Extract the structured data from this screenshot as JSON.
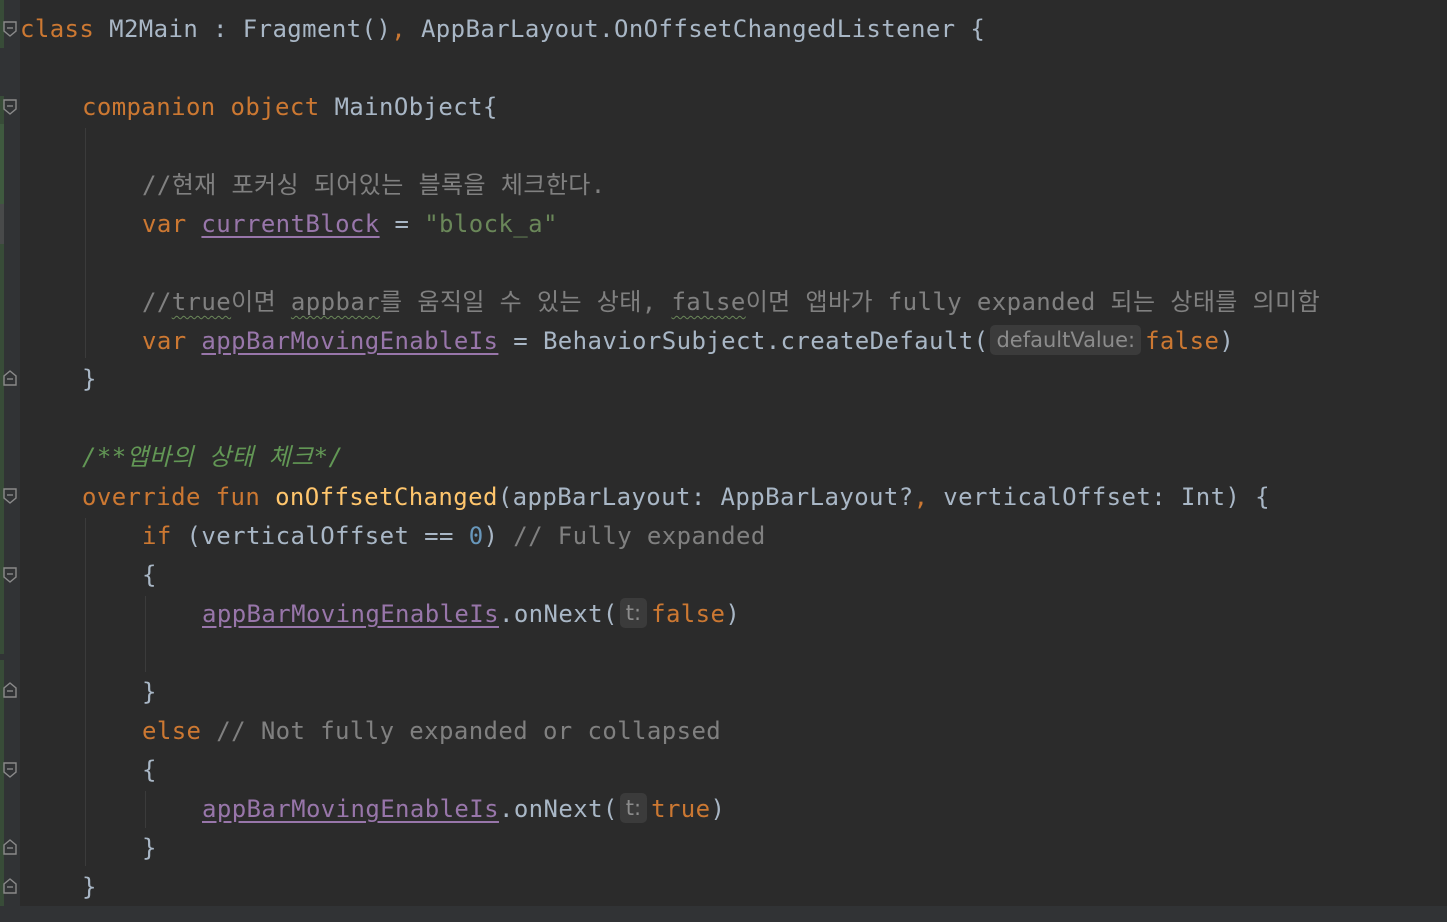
{
  "editor": {
    "lines": [
      {
        "id": "class-decl",
        "tokens": [
          {
            "t": "class",
            "c": "kw"
          },
          {
            "t": " M2Main : Fragment()",
            "c": "plain"
          },
          {
            "t": ",",
            "c": "kw"
          },
          {
            "t": " AppBarLayout.OnOffsetChangedListener {",
            "c": "plain"
          }
        ]
      },
      {
        "id": "companion-decl",
        "tokens": [
          {
            "t": "companion object",
            "c": "kw"
          },
          {
            "t": " MainObject{",
            "c": "plain"
          }
        ]
      },
      {
        "id": "comment-current-block",
        "tokens": [
          {
            "t": "//현재 포커싱 되어있는 블록을 체크한다.",
            "c": "comment"
          }
        ]
      },
      {
        "id": "var-current-block",
        "tokens": [
          {
            "t": "var",
            "c": "kw"
          },
          {
            "t": " ",
            "c": "plain"
          },
          {
            "t": "currentBlock",
            "c": "prop"
          },
          {
            "t": " = ",
            "c": "plain"
          },
          {
            "t": "\"block_a\"",
            "c": "str"
          }
        ]
      },
      {
        "id": "comment-appbar",
        "tokens": [
          {
            "t": "//",
            "c": "comment"
          },
          {
            "t": "true",
            "c": "comment typo"
          },
          {
            "t": "이면 ",
            "c": "comment"
          },
          {
            "t": "appbar",
            "c": "comment typo"
          },
          {
            "t": "를 움직일 수 있는 상태, ",
            "c": "comment"
          },
          {
            "t": "false",
            "c": "comment typo"
          },
          {
            "t": "이면 앱바가 fully expanded 되는 상태를 의미함",
            "c": "comment"
          }
        ]
      },
      {
        "id": "var-appbar-enable",
        "tokens": [
          {
            "t": "var",
            "c": "kw"
          },
          {
            "t": " ",
            "c": "plain"
          },
          {
            "t": "appBarMovingEnableIs",
            "c": "prop"
          },
          {
            "t": " = BehaviorSubject.createDefault(",
            "c": "plain"
          },
          {
            "t": "defaultValue:",
            "c": "hint"
          },
          {
            "t": "false",
            "c": "kw"
          },
          {
            "t": ")",
            "c": "plain"
          }
        ]
      },
      {
        "id": "companion-close",
        "tokens": [
          {
            "t": "}",
            "c": "plain"
          }
        ]
      },
      {
        "id": "doc-comment",
        "tokens": [
          {
            "t": "/**앱바의 상태 체크*/",
            "c": "doc"
          }
        ]
      },
      {
        "id": "fun-decl",
        "tokens": [
          {
            "t": "override fun",
            "c": "kw"
          },
          {
            "t": " ",
            "c": "plain"
          },
          {
            "t": "onOffsetChanged",
            "c": "fn"
          },
          {
            "t": "(appBarLayout: AppBarLayout?",
            "c": "plain"
          },
          {
            "t": ",",
            "c": "kw"
          },
          {
            "t": " verticalOffset: Int) {",
            "c": "plain"
          }
        ]
      },
      {
        "id": "if-stmt",
        "tokens": [
          {
            "t": "if",
            "c": "kw"
          },
          {
            "t": " (verticalOffset == ",
            "c": "plain"
          },
          {
            "t": "0",
            "c": "num"
          },
          {
            "t": ") ",
            "c": "plain"
          },
          {
            "t": "// Fully expanded",
            "c": "comment"
          }
        ]
      },
      {
        "id": "if-open",
        "tokens": [
          {
            "t": "{",
            "c": "plain"
          }
        ]
      },
      {
        "id": "on-next-false",
        "tokens": [
          {
            "t": "appBarMovingEnableIs",
            "c": "prop"
          },
          {
            "t": ".onNext(",
            "c": "plain"
          },
          {
            "t": "t:",
            "c": "hint"
          },
          {
            "t": "false",
            "c": "kw"
          },
          {
            "t": ")",
            "c": "plain"
          }
        ]
      },
      {
        "id": "if-close",
        "tokens": [
          {
            "t": "}",
            "c": "plain"
          }
        ]
      },
      {
        "id": "else-stmt",
        "tokens": [
          {
            "t": "else",
            "c": "kw"
          },
          {
            "t": " ",
            "c": "plain"
          },
          {
            "t": "// Not fully expanded or collapsed",
            "c": "comment"
          }
        ]
      },
      {
        "id": "else-open",
        "tokens": [
          {
            "t": "{",
            "c": "plain"
          }
        ]
      },
      {
        "id": "on-next-true",
        "tokens": [
          {
            "t": "appBarMovingEnableIs",
            "c": "prop"
          },
          {
            "t": ".onNext(",
            "c": "plain"
          },
          {
            "t": "t:",
            "c": "hint"
          },
          {
            "t": "true",
            "c": "kw"
          },
          {
            "t": ")",
            "c": "plain"
          }
        ]
      },
      {
        "id": "else-close",
        "tokens": [
          {
            "t": "}",
            "c": "plain"
          }
        ]
      },
      {
        "id": "fun-close",
        "tokens": [
          {
            "t": "}",
            "c": "plain"
          }
        ]
      }
    ]
  },
  "icons": {
    "fold_open": "fold-collapse-icon",
    "fold_end": "fold-end-icon"
  },
  "colors": {
    "background": "#2b2b2b",
    "gutter": "#313335",
    "keyword": "#cc7832",
    "function": "#ffc66d",
    "string": "#6a8759",
    "number": "#6897bb",
    "comment": "#808080",
    "doc_comment": "#629755",
    "property": "#9876aa",
    "text": "#a9b7c6"
  }
}
